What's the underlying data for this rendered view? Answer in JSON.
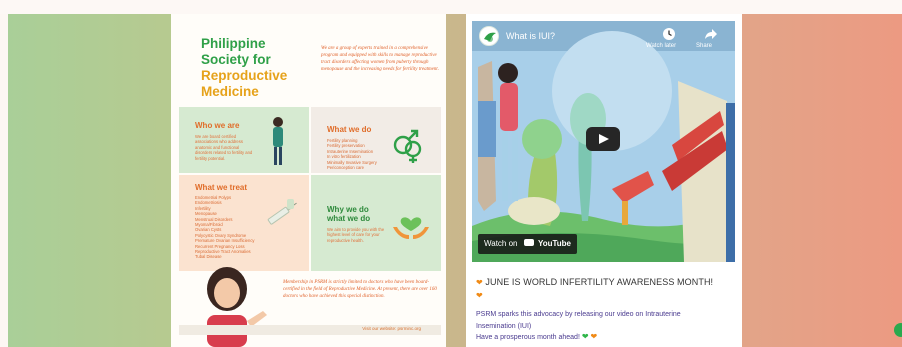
{
  "poster": {
    "title_line1": "Philippine",
    "title_line2": "Society for",
    "title_line3": "Reproductive",
    "title_line4": "Medicine",
    "intro": "We are a group of experts trained in a comprehensive program and equipped with skills to manage reproductive tract disorders affecting women from puberty through menopause and the increasing needs for fertility treatment.",
    "who_heading": "Who we are",
    "who_text": "We are board certified associations who address anatomic and functional disorders related to fertility and fertility potential.",
    "what_do_heading": "What we do",
    "what_do_items": [
      "Fertility planning",
      "Fertility preservation",
      "Intrauterine Insemination",
      "In vitro fertilization",
      "Minimally Invasive Surgery",
      "Periconception care"
    ],
    "treat_heading": "What we treat",
    "treat_items": [
      "Endometrial Polyps",
      "Endometriosis",
      "Infertility",
      "Menopause",
      "Menstrual Disorders",
      "Myoma/Fibroid",
      "Ovarian Cysts",
      "Polycystic Ovary Syndrome",
      "Premature Ovarian Insufficiency",
      "Recurrent Pregnancy Loss",
      "Reproductive Tract Anomalies",
      "Tubal Disease"
    ],
    "why_heading_line1": "Why we do",
    "why_heading_line2": "what we do",
    "why_text": "We aim to provide you with the highest level of care for your reproductive health.",
    "membership": "Membership in PSRM is strictly limited to doctors who have been board-certified in the field of Reproductive Medicine. At present, there are over 160 doctors who have achieved this special distinction.",
    "footer": "Visit our website: psrminc.org"
  },
  "video": {
    "title": "What is IUI?",
    "watch_later": "Watch later",
    "share": "Share",
    "watch_on": "Watch on",
    "youtube": "YouTube"
  },
  "post": {
    "heading": "JUNE IS WORLD INFERTILITY AWARENESS MONTH!",
    "body_line1": "PSRM sparks this advocacy by releasing our video on Intrauterine",
    "body_line2": "Insemination (IUI)",
    "body_line3": "Have a prosperous month ahead!"
  },
  "colors": {
    "brand_green": "#2fa048",
    "brand_orange": "#e06d2a",
    "brand_yellow": "#e6a21a"
  }
}
